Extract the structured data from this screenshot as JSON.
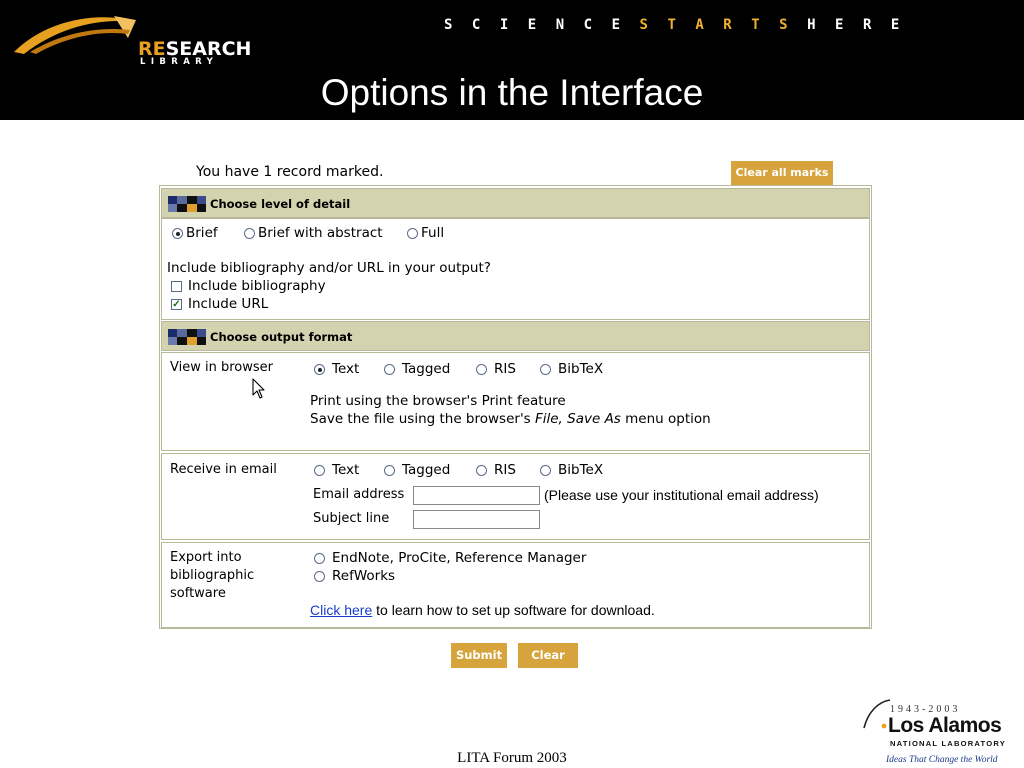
{
  "header": {
    "logo_prefix": "RE",
    "logo_main": "SEARCH",
    "logo_sub": "LIBRARY",
    "tagline_a": "SCIENCE",
    "tagline_b": "STARTS",
    "tagline_c": "HERE",
    "slide_title": "Options in the Interface"
  },
  "marks": {
    "status_text": "You have 1 record marked.",
    "clear_all_label": "Clear all marks"
  },
  "detail": {
    "heading": "Choose level of detail",
    "options": [
      "Brief",
      "Brief with abstract",
      "Full"
    ],
    "selected": "Brief",
    "include_question": "Include bibliography and/or URL in your output?",
    "include_bibliography": "Include bibliography",
    "include_url": "Include URL",
    "bibliography_checked": false,
    "url_checked": true
  },
  "output": {
    "heading": "Choose output format",
    "browser": {
      "label": "View in browser",
      "formats": [
        "Text",
        "Tagged",
        "RIS",
        "BibTeX"
      ],
      "selected": "Text",
      "print_hint": "Print using the browser's Print feature",
      "save_hint_prefix": "Save the file using the browser's ",
      "save_hint_italic": "File, Save As",
      "save_hint_suffix": " menu option"
    },
    "email": {
      "label": "Receive in email",
      "formats": [
        "Text",
        "Tagged",
        "RIS",
        "BibTeX"
      ],
      "email_label": "Email address",
      "email_value": "",
      "email_hint": "(Please use your institutional email address)",
      "subject_label": "Subject line",
      "subject_value": ""
    },
    "export": {
      "label_line1": "Export into",
      "label_line2": "bibliographic",
      "label_line3": "software",
      "options": [
        "EndNote, ProCite, Reference Manager",
        "RefWorks"
      ],
      "link_text": "Click here",
      "link_suffix": " to learn how to set up software for download."
    }
  },
  "actions": {
    "submit_label": "Submit",
    "clear_label": "Clear"
  },
  "footer": {
    "text": "LITA Forum 2003",
    "lanl_years": "1943-2003",
    "lanl_name": "Los Alamos",
    "lanl_national": "NATIONAL LABORATORY",
    "lanl_ideas": "Ideas That Change the World"
  },
  "colors": {
    "banner": "#000000",
    "accent_gold": "#d6a33c",
    "section_header": "#d4d3b0",
    "link_blue": "#1a3ec8"
  }
}
